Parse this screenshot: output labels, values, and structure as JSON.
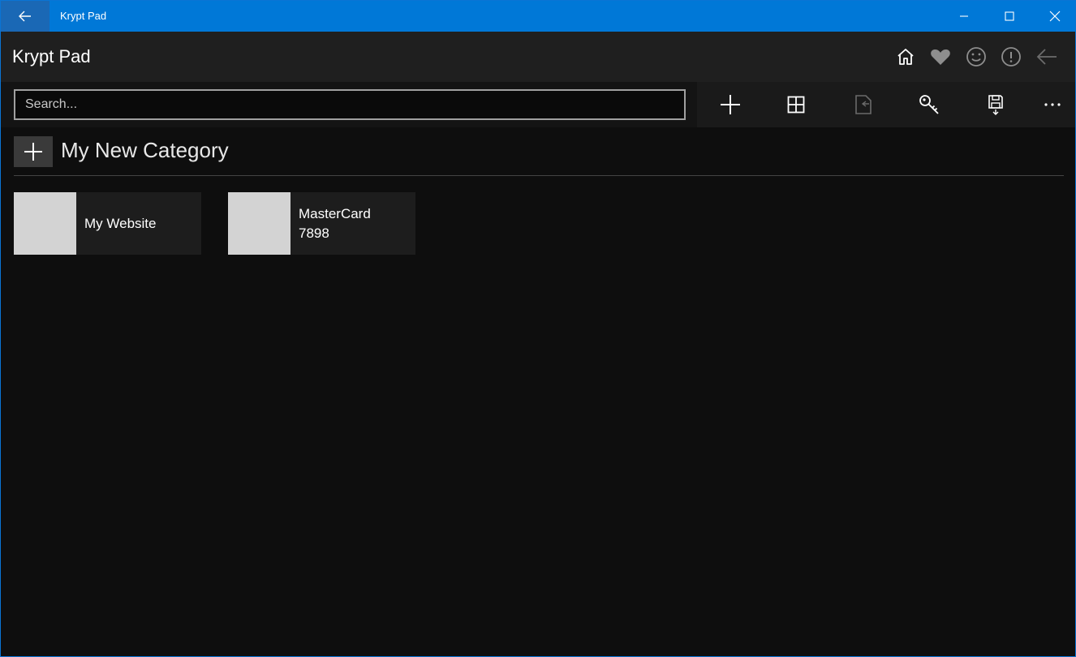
{
  "window": {
    "title": "Krypt Pad",
    "accent": "#0078d7"
  },
  "header": {
    "app_title": "Krypt Pad",
    "icons": [
      "home-icon",
      "heart-icon",
      "smiley-icon",
      "info-icon",
      "back-arrow-icon"
    ]
  },
  "search": {
    "placeholder": "Search...",
    "value": ""
  },
  "commands": [
    "add-icon",
    "grid-icon",
    "import-icon",
    "key-icon",
    "save-icon",
    "more-icon"
  ],
  "category": {
    "name": "My New Category",
    "items": [
      {
        "title": "My Website",
        "subtitle": ""
      },
      {
        "title": "MasterCard",
        "subtitle": "7898"
      }
    ]
  }
}
